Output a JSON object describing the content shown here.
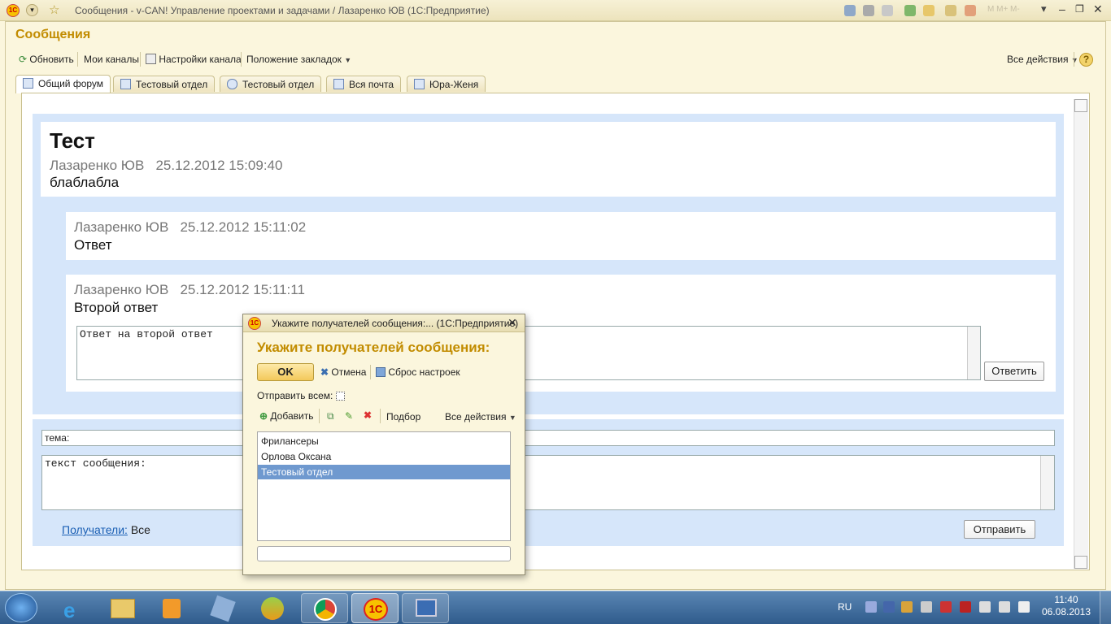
{
  "window": {
    "title": "Сообщения - v-CAN! Управление проектами и задачами / Лазаренко ЮВ  (1С:Предприятие)"
  },
  "page": {
    "title": "Сообщения"
  },
  "toolbar": {
    "refresh": "Обновить",
    "my_channels": "Мои каналы",
    "channel_settings": "Настройки канала",
    "tab_position": "Положение закладок",
    "all_actions": "Все действия",
    "help": "?"
  },
  "tabs": [
    {
      "label": "Общий форум",
      "active": true
    },
    {
      "label": "Тестовый отдел",
      "active": false
    },
    {
      "label": "Тестовый отдел",
      "active": false
    },
    {
      "label": "Вся почта",
      "active": false
    },
    {
      "label": "Юра-Женя",
      "active": false
    }
  ],
  "topic": {
    "title": "Тест",
    "author": "Лазаренко ЮВ",
    "date": "25.12.2012 15:09:40",
    "text": "блаблабла"
  },
  "replies": [
    {
      "author": "Лазаренко ЮВ",
      "date": "25.12.2012 15:11:02",
      "text": "Ответ"
    },
    {
      "author": "Лазаренко ЮВ",
      "date": "25.12.2012 15:11:11",
      "text": "Второй ответ"
    }
  ],
  "reply_box": {
    "value": "Ответ на второй ответ",
    "button": "Ответить"
  },
  "compose": {
    "subject": "тема:",
    "text": "текст сообщения:",
    "recipients_link": "Получатели:",
    "recipients_value": "Все",
    "send": "Отправить"
  },
  "dialog": {
    "title": "Укажите получателей сообщения:...  (1С:Предприятие)",
    "heading": "Укажите получателей сообщения:",
    "ok": "OK",
    "cancel": "Отмена",
    "reset": "Сброс настроек",
    "send_all": "Отправить всем:",
    "add": "Добавить",
    "pick": "Подбор",
    "all_actions": "Все действия",
    "items": [
      "Фрилансеры",
      "Орлова Оксана",
      "Тестовый отдел"
    ],
    "selected_index": 2
  },
  "taskbar": {
    "lang": "RU",
    "time": "11:40",
    "date": "06.08.2013"
  },
  "colors": {
    "accent": "#c28c00",
    "forum_bg": "#d6e6fa",
    "selection": "#6f99cf"
  }
}
